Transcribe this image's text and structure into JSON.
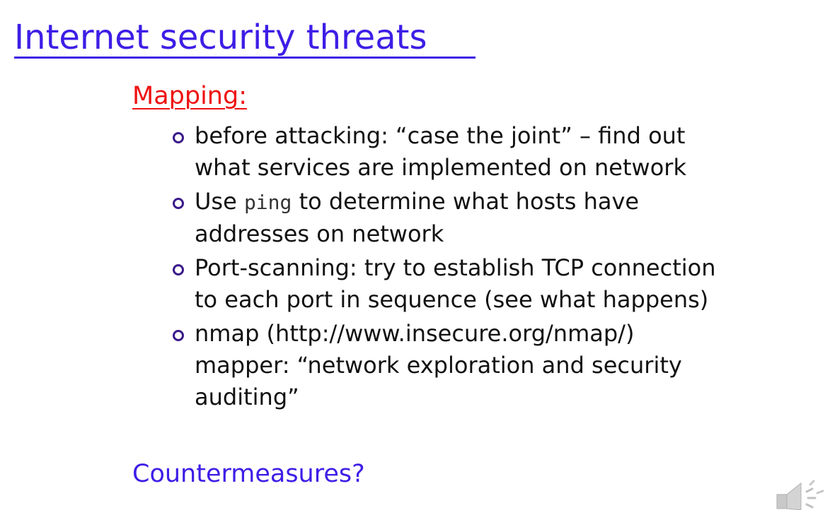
{
  "slide": {
    "title": "Internet security threats",
    "section_heading": "Mapping:",
    "bullets": [
      {
        "lines": [
          "before attacking: “case the joint” – find out",
          "what services are implemented on network"
        ]
      },
      {
        "line1_before": "Use ",
        "line1_code": "ping",
        "line1_after": " to determine what hosts have",
        "line2": "addresses on network"
      },
      {
        "lines": [
          "Port-scanning: try to establish TCP connection",
          "to each port in sequence (see what happens)"
        ]
      },
      {
        "lines": [
          "nmap (http://www.insecure.org/nmap/)",
          "mapper: “network exploration and security",
          "auditing”"
        ]
      }
    ],
    "footer_question": "Countermeasures?"
  },
  "icons": {
    "speaker": "speaker-audio-icon"
  },
  "colors": {
    "title": "#3d1ee6",
    "heading": "#ee1111",
    "body_text": "#111111",
    "bullet_marker": "#3a1a8a",
    "background": "#ffffff"
  }
}
